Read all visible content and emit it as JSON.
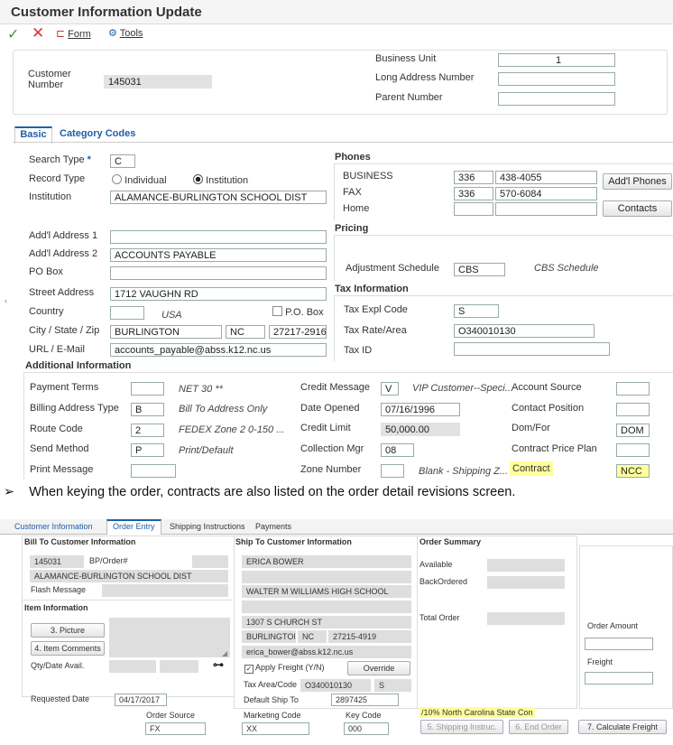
{
  "title": "Customer Information Update",
  "toolbar": {
    "form_label": "Form",
    "tools_label": "Tools"
  },
  "header": {
    "customer_number_label": "Customer\nNumber",
    "customer_number": "145031",
    "business_unit_label": "Business Unit",
    "business_unit": "1",
    "long_address_label": "Long Address Number",
    "parent_number_label": "Parent Number"
  },
  "tabs": [
    "Basic",
    "Category Codes"
  ],
  "basic": {
    "search_type_label": "Search Type",
    "search_type": "C",
    "record_type_label": "Record Type",
    "record_type_options": [
      "Individual",
      "Institution"
    ],
    "institution_label": "Institution",
    "institution": "ALAMANCE-BURLINGTON SCHOOL DIST",
    "addl1_label": "Add'l Address 1",
    "addl2_label": "Add'l Address 2",
    "addl2": "ACCOUNTS PAYABLE",
    "po_box_label": "PO Box",
    "street_label": "Street Address",
    "street": "1712 VAUGHN RD",
    "country_label": "Country",
    "country_desc": "USA",
    "po_box_check_label": "P.O. Box",
    "city_label": "City / State / Zip",
    "city": "BURLINGTON",
    "state": "NC",
    "zip": "27217-2916",
    "url_label": "URL / E-Mail",
    "email": "accounts_payable@abss.k12.nc.us"
  },
  "phones": {
    "title": "Phones",
    "rows": [
      {
        "label": "BUSINESS",
        "area": "336",
        "number": "438-4055"
      },
      {
        "label": "FAX",
        "area": "336",
        "number": "570-6084"
      },
      {
        "label": "Home",
        "area": "",
        "number": ""
      }
    ],
    "addl_phones_button": "Add'l Phones",
    "contacts_button": "Contacts"
  },
  "pricing": {
    "title": "Pricing",
    "adj_label": "Adjustment Schedule",
    "adj_value": "CBS",
    "adj_desc": "CBS Schedule"
  },
  "tax": {
    "title": "Tax Information",
    "expl_label": "Tax Expl Code",
    "expl": "S",
    "rate_label": "Tax Rate/Area",
    "rate": "O340010130",
    "id_label": "Tax ID"
  },
  "additional": {
    "title": "Additional Information",
    "payment_terms_label": "Payment Terms",
    "payment_terms_desc": "NET 30 **",
    "billing_label": "Billing Address Type",
    "billing": "B",
    "billing_desc": "Bill To Address Only",
    "route_label": "Route Code",
    "route": "2",
    "route_desc": "FEDEX Zone 2 0-150 ...",
    "send_label": "Send Method",
    "send": "P",
    "send_desc": "Print/Default",
    "print_label": "Print Message",
    "credit_msg_label": "Credit Message",
    "credit_msg": "V",
    "credit_msg_desc": "VIP Customer--Speci...",
    "date_opened_label": "Date Opened",
    "date_opened": "07/16/1996",
    "credit_limit_label": "Credit Limit",
    "credit_limit": "50,000.00",
    "collection_label": "Collection Mgr",
    "collection": "08",
    "zone_label": "Zone Number",
    "zone_desc": "Blank - Shipping Z...",
    "account_source_label": "Account Source",
    "contact_position_label": "Contact Position",
    "dom_label": "Dom/For",
    "dom": "DOM",
    "contract_price_label": "Contract Price Plan",
    "contract_label": "Contract",
    "contract": "NCC"
  },
  "note": {
    "bullet": "➢",
    "text": "When keying the order, contracts are also listed on the order detail revisions screen."
  },
  "order": {
    "tabs": [
      "Customer Information",
      "Order Entry",
      "Shipping Instructions",
      "Payments"
    ],
    "bill_to_title": "Bill To Customer Information",
    "bill_customer": "145031",
    "bp_order_label": "BP/Order#",
    "bill_name": "ALAMANCE-BURLINGTON SCHOOL DIST",
    "flash_label": "Flash Message",
    "item_info_title": "Item Information",
    "picture_button": "3. Picture",
    "item_comments_button": "4. Item Comments",
    "qty_label": "Qty/Date Avail.",
    "requested_label": "Requested Date",
    "requested": "04/17/2017",
    "ship_to_title": "Ship To Customer Information",
    "ship_contact": "ERICA BOWER",
    "ship_name": "WALTER M WILLIAMS HIGH SCHOOL",
    "ship_street": "1307 S CHURCH ST",
    "ship_city": "BURLINGTON",
    "ship_state": "NC",
    "ship_zip": "27215-4919",
    "ship_email": "erica_bower@abss.k12.nc.us",
    "apply_freight_label": "Apply Freight (Y/N)",
    "override_button": "Override",
    "tax_area_label": "Tax Area/Code",
    "tax_area": "O340010130",
    "tax_code": "S",
    "default_ship_label": "Default Ship To",
    "default_ship": "2897425",
    "summary_title": "Order Summary",
    "available_label": "Available",
    "backordered_label": "BackOrdered",
    "total_label": "Total Order",
    "order_amount_label": "Order Amount",
    "freight_label": "Freight",
    "contract_text": "/10% North Carolina State Con",
    "order_source_label": "Order Source",
    "order_source": "FX",
    "marketing_label": "Marketing Code",
    "marketing": "XX",
    "key_code_label": "Key Code",
    "key_code": "000",
    "shipping_instr_button": "5. Shipping Instruc.",
    "end_order_button": "6. End Order",
    "calc_freight_button": "7. Calculate Freight"
  },
  "colors": {
    "accent": "#1f5fa8",
    "highlight": "#ffff9c",
    "readonly": "#e2e2e2"
  }
}
